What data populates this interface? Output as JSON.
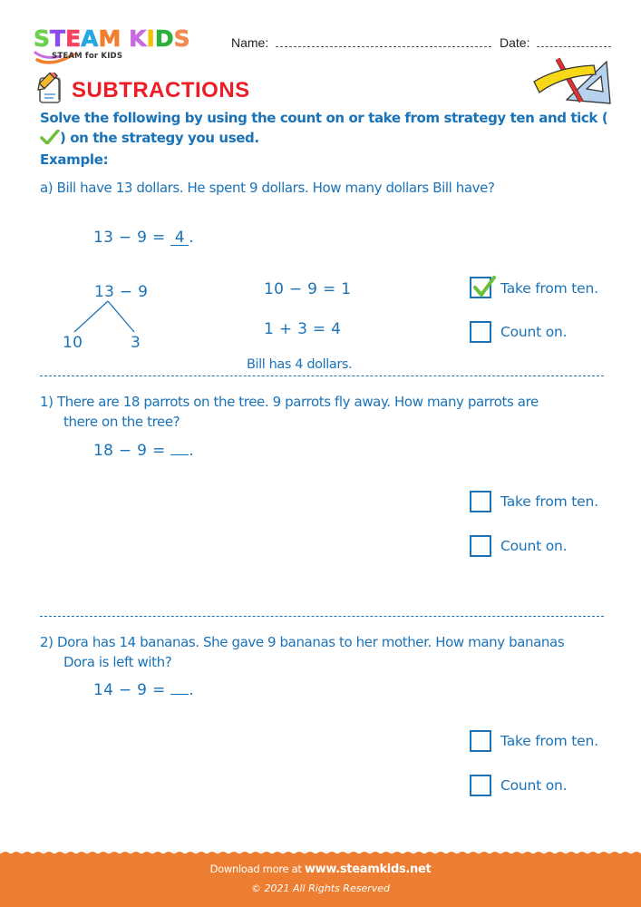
{
  "logo": {
    "letters": [
      {
        "ch": "S",
        "color": "#6fcf4f"
      },
      {
        "ch": "T",
        "color": "#8a4cf0"
      },
      {
        "ch": "E",
        "color": "#f5425e"
      },
      {
        "ch": "A",
        "color": "#26a8e0"
      },
      {
        "ch": "M",
        "color": "#f08030"
      },
      {
        "ch": " ",
        "color": "#ffffff"
      },
      {
        "ch": "K",
        "color": "#c86adf"
      },
      {
        "ch": "I",
        "color": "#f5c000"
      },
      {
        "ch": "D",
        "color": "#2cb03c"
      },
      {
        "ch": "S",
        "color": "#f58a50"
      }
    ],
    "tagline": "STEAM for KIDS"
  },
  "header": {
    "name_label": "Name:",
    "date_label": "Date:",
    "title": "SUBTRACTIONS"
  },
  "instructions": {
    "text_before_tick": "Solve the following by using the count on or take from strategy ten and tick (",
    "text_after_tick": ") on the strategy you used.",
    "example_label": "Example:"
  },
  "example": {
    "question": "a)  Bill have 13 dollars. He spent 9 dollars. How many dollars Bill have?",
    "equation_left": "13 − 9 = ",
    "equation_answer": "4",
    "equation_end": ".",
    "tree_top": "13 − 9",
    "tree_left": "10",
    "tree_right": "3",
    "step1": "10 − 9 = 1",
    "step2": "1 + 3 = 4",
    "conclusion": "Bill has 4 dollars.",
    "options": [
      {
        "label": "Take from ten.",
        "checked": true
      },
      {
        "label": "Count on.",
        "checked": false
      }
    ]
  },
  "questions": [
    {
      "line1": "1)  There are 18 parrots on the tree. 9 parrots fly away. How many parrots are",
      "line2": "there on the tree?",
      "equation_left": "18 − 9 = ",
      "equation_answer": "",
      "equation_end": ".",
      "options": [
        {
          "label": "Take from ten.",
          "checked": false
        },
        {
          "label": "Count on.",
          "checked": false
        }
      ]
    },
    {
      "line1": "2)  Dora has 14 bananas. She gave 9 bananas to her mother. How many bananas",
      "line2": "Dora is left with?",
      "equation_left": "14 − 9 = ",
      "equation_answer": "",
      "equation_end": ".",
      "options": [
        {
          "label": "Take from ten.",
          "checked": false
        },
        {
          "label": "Count on.",
          "checked": false
        }
      ]
    }
  ],
  "footer": {
    "download_prefix": "Download more at ",
    "download_url": "www.steamkids.net",
    "copyright": "©  2021 All Rights Reserved",
    "color": "#ed7d31"
  },
  "colors": {
    "text_blue": "#1a73b8",
    "title_red": "#ee1c25",
    "tick_green": "#6cbf3a"
  }
}
